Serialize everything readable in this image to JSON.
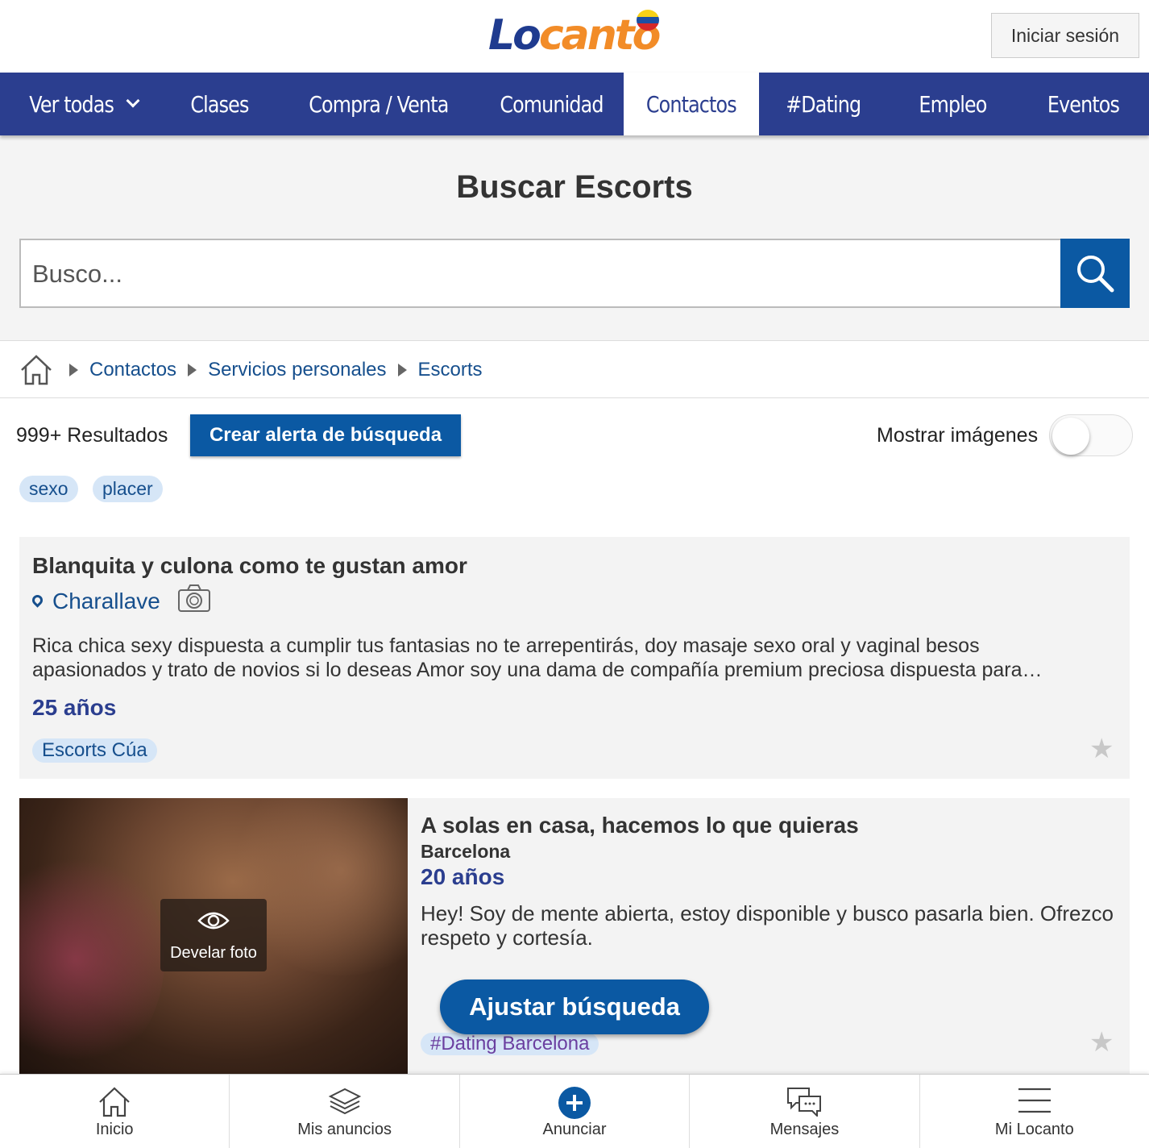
{
  "header": {
    "logo_part1": "Lo",
    "logo_part2": "canto",
    "login_label": "Iniciar sesión"
  },
  "nav": {
    "items": [
      {
        "label": "Ver todas"
      },
      {
        "label": "Clases"
      },
      {
        "label": "Compra / Venta"
      },
      {
        "label": "Comunidad"
      },
      {
        "label": "Contactos",
        "active": true
      },
      {
        "label": "#Dating"
      },
      {
        "label": "Empleo"
      },
      {
        "label": "Eventos"
      }
    ]
  },
  "search": {
    "title": "Buscar Escorts",
    "placeholder": "Busco..."
  },
  "breadcrumb": {
    "items": [
      "Contactos",
      "Servicios personales",
      "Escorts"
    ]
  },
  "results": {
    "count_text": "999+ Resultados",
    "alert_button": "Crear alerta de búsqueda",
    "show_images_label": "Mostrar imágenes",
    "show_images_enabled": false
  },
  "tags": [
    "sexo",
    "placer"
  ],
  "listings": [
    {
      "title": "Blanquita y culona como te gustan amor",
      "location": "Charallave",
      "description_line1": "Rica chica sexy dispuesta a cumplir tus fantasias no te arrepentirás, doy masaje sexo oral y vaginal besos",
      "description_line2": "apasionados y trato de novios si lo deseas Amor soy una dama de compañía premium preciosa dispuesta para…",
      "age": "25 años",
      "category": "Escorts Cúa"
    },
    {
      "title": "A solas en casa, hacemos lo que quieras",
      "location": "Barcelona",
      "age": "20 años",
      "description_line1": "Hey! Soy de mente abierta, estoy disponible y busco pasarla bien. Ofrezco",
      "description_line2": "respeto y cortesía.",
      "category": "#Dating Barcelona",
      "reveal_label": "Develar foto"
    }
  ],
  "adjust_button": "Ajustar búsqueda",
  "bottom_bar": {
    "items": [
      {
        "label": "Inicio",
        "icon": "home-icon"
      },
      {
        "label": "Mis anuncios",
        "icon": "layers-icon"
      },
      {
        "label": "Anunciar",
        "icon": "plus-circle-icon"
      },
      {
        "label": "Mensajes",
        "icon": "chat-icon"
      },
      {
        "label": "Mi Locanto",
        "icon": "menu-icon"
      }
    ]
  },
  "colors": {
    "nav_bg": "#2b3e8f",
    "primary_button": "#0b59a3",
    "link": "#164f8d",
    "pill_bg": "#d6e6f7"
  }
}
